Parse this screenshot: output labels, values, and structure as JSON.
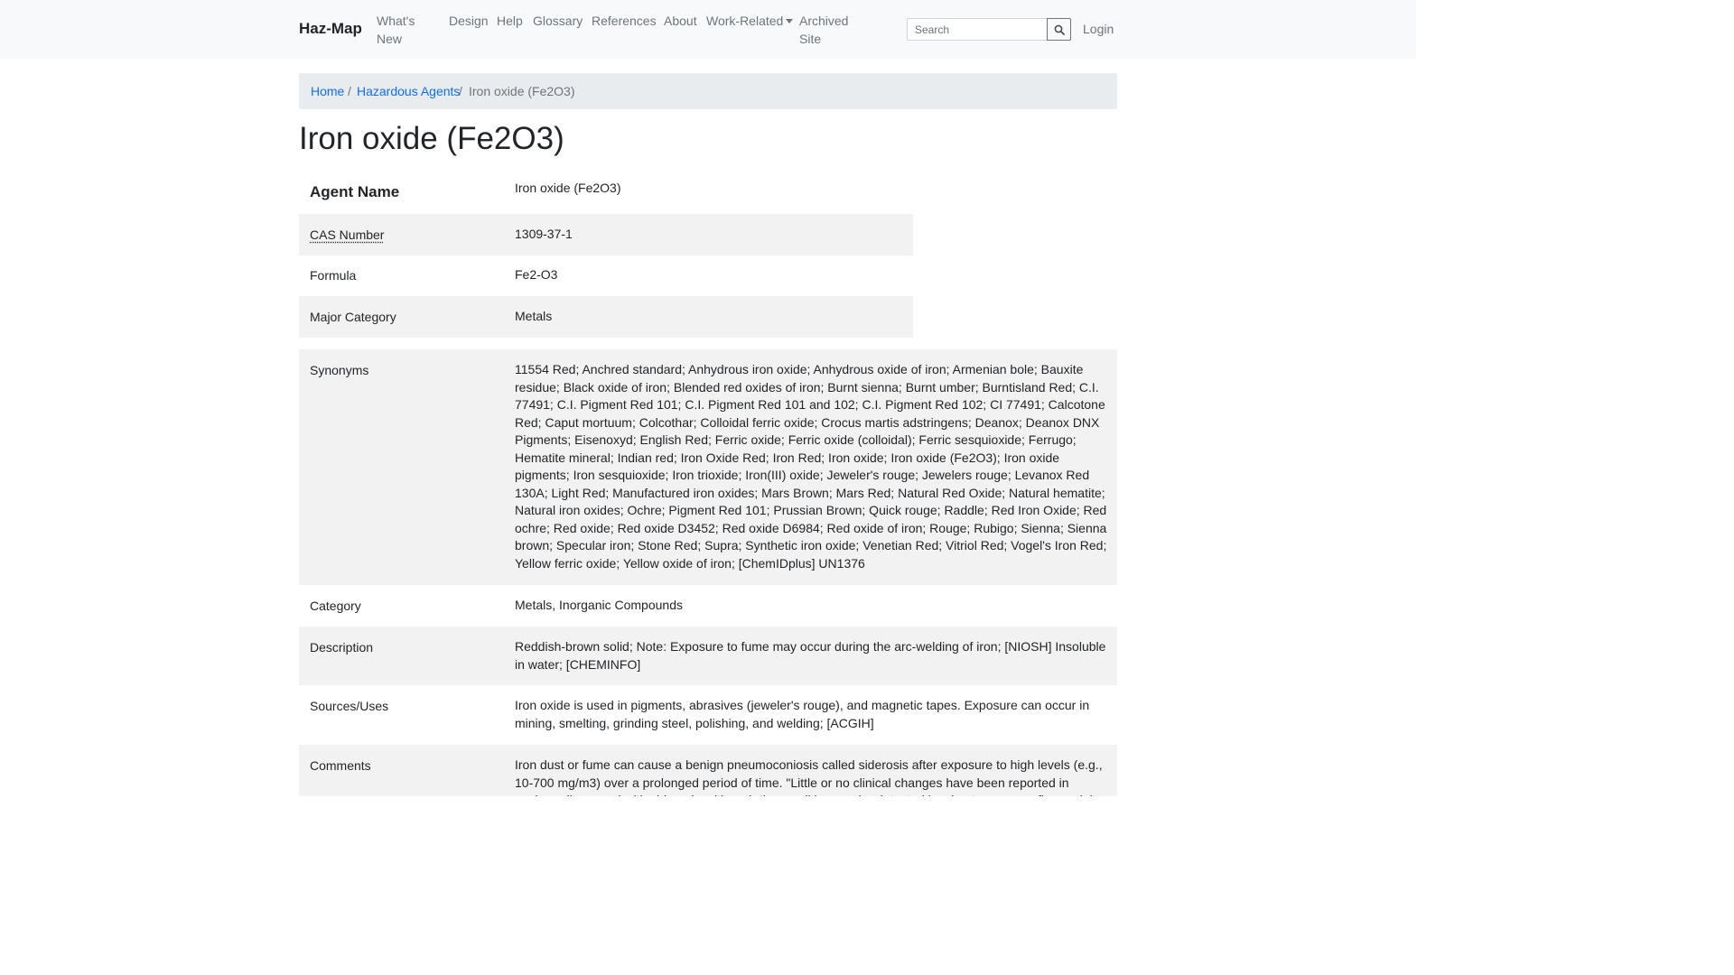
{
  "nav": {
    "brand": "Haz-Map",
    "links": [
      "What's New",
      "Design",
      "Help",
      "Glossary",
      "References",
      "About",
      "Work-Related",
      "Archived Site"
    ],
    "search_placeholder": "Search",
    "login": "Login"
  },
  "breadcrumb": {
    "home": "Home",
    "separator": "/",
    "section": "Hazardous Agents",
    "current": "Iron oxide (Fe2O3)"
  },
  "page_title": "Iron oxide (Fe2O3)",
  "details": {
    "agent_name": {
      "label": "Agent Name",
      "value": "Iron oxide (Fe2O3)"
    },
    "cas_number": {
      "label": "CAS Number",
      "value": "1309-37-1"
    },
    "formula": {
      "label": "Formula",
      "value": "Fe2-O3"
    },
    "major_category": {
      "label": "Major Category",
      "value": "Metals"
    },
    "synonyms": {
      "label": "Synonyms",
      "value": "11554 Red; Anchred standard; Anhydrous iron oxide; Anhydrous oxide of iron; Armenian bole; Bauxite residue; Black oxide of iron; Blended red oxides of iron; Burnt sienna; Burnt umber; Burntisland Red; C.I. 77491; C.I. Pigment Red 101; C.I. Pigment Red 101 and 102; C.I. Pigment Red 102; CI 77491; Calcotone Red; Caput mortuum; Colcothar; Colloidal ferric oxide; Crocus martis adstringens; Deanox; Deanox DNX Pigments; Eisenoxyd; English Red; Ferric oxide; Ferric oxide (colloidal); Ferric sesquioxide; Ferrugo; Hematite mineral; Indian red; Iron Oxide Red; Iron Red; Iron oxide; Iron oxide (Fe2O3); Iron oxide pigments; Iron sesquioxide; Iron trioxide; Iron(III) oxide; Jeweler's rouge; Jewelers rouge; Levanox Red 130A; Light Red; Manufactured iron oxides; Mars Brown; Mars Red; Natural Red Oxide; Natural hematite; Natural iron oxides; Ochre; Pigment Red 101; Prussian Brown; Quick rouge; Raddle; Red Iron Oxide; Red ochre; Red oxide; Red oxide D3452; Red oxide D6984; Red oxide of iron; Rouge; Rubigo; Sienna; Sienna brown; Specular iron; Stone Red; Supra; Synthetic iron oxide; Venetian Red; Vitriol Red; Vogel's Iron Red; Yellow ferric oxide; Yellow oxide of iron; [ChemIDplus] UN1376"
    },
    "category": {
      "label": "Category",
      "value": "Metals, Inorganic Compounds"
    },
    "description": {
      "label": "Description",
      "value": "Reddish-brown solid; Note: Exposure to fume may occur during the arc-welding of iron; [NIOSH] Insoluble in water; [CHEMINFO]"
    },
    "sources_uses": {
      "label": "Sources/Uses",
      "value": "Iron oxide is used in pigments, abrasives (jeweler's rouge), and magnetic tapes. Exposure can occur in mining, smelting, grinding steel, polishing, and welding; [ACGIH]"
    },
    "comments": {
      "label": "Comments",
      "value": "Iron dust or fume can cause a benign pneumoconiosis called siderosis after exposure to high levels (e.g., 10-700 mg/m3) over a prolonged period of time. \"Little or no clinical changes have been reported in workers diagnosed with siderosis, although the condition can be detected by chest x-ray as a fine nodular pattern.\" Because both"
    }
  }
}
